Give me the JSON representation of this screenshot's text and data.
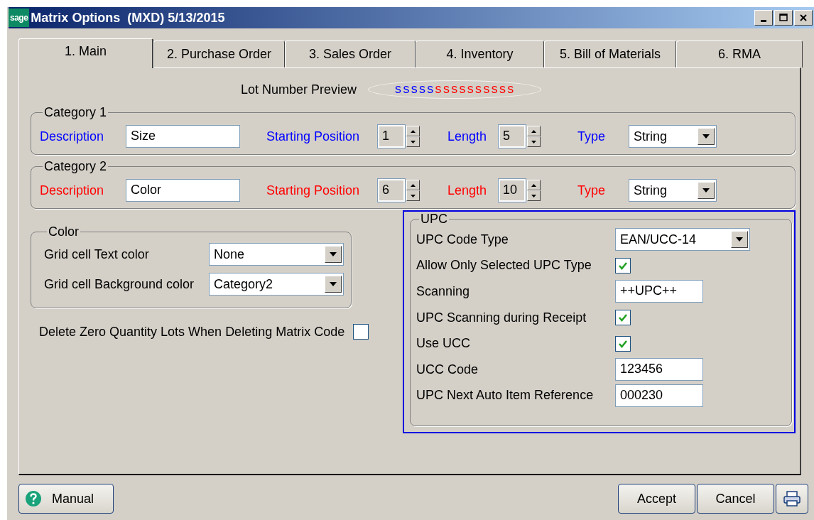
{
  "window": {
    "logo": "sage",
    "title": "Matrix Options  (MXD) 5/13/2015"
  },
  "tabs": [
    {
      "label": "1. Main",
      "selected": true
    },
    {
      "label": "2. Purchase Order",
      "selected": false
    },
    {
      "label": "3. Sales Order",
      "selected": false
    },
    {
      "label": "4. Inventory",
      "selected": false
    },
    {
      "label": "5. Bill of Materials",
      "selected": false
    },
    {
      "label": "6. RMA",
      "selected": false
    }
  ],
  "lot_number_preview": {
    "label": "Lot Number Preview",
    "segments": [
      {
        "text": "sssss",
        "color": "#0000ff"
      },
      {
        "text": "ssssssssss",
        "color": "#ff0000"
      }
    ]
  },
  "categories": [
    {
      "title": "Category 1",
      "color": "#0000ff",
      "description_label": "Description",
      "description": "Size",
      "start_label": "Starting Position",
      "start": "1",
      "length_label": "Length",
      "length": "5",
      "type_label": "Type",
      "type": "String"
    },
    {
      "title": "Category 2",
      "color": "#ff0000",
      "description_label": "Description",
      "description": "Color",
      "start_label": "Starting Position",
      "start": "6",
      "length_label": "Length",
      "length": "10",
      "type_label": "Type",
      "type": "String"
    }
  ],
  "color_group": {
    "title": "Color",
    "rows": [
      {
        "label": "Grid cell Text color",
        "value": "None"
      },
      {
        "label": "Grid cell Background color",
        "value": "Category2"
      }
    ]
  },
  "delete_zero_lots": {
    "label": "Delete Zero Quantity Lots When Deleting Matrix Code",
    "checked": false
  },
  "upc": {
    "title": "UPC",
    "rows": [
      {
        "kind": "select",
        "label": "UPC Code Type",
        "value": "EAN/UCC-14"
      },
      {
        "kind": "checkbox",
        "label": "Allow Only Selected UPC Type",
        "checked": true
      },
      {
        "kind": "text",
        "label": "Scanning",
        "value": "++UPC++"
      },
      {
        "kind": "checkbox",
        "label": "UPC Scanning during Receipt",
        "checked": true
      },
      {
        "kind": "checkbox",
        "label": "Use UCC",
        "checked": true
      },
      {
        "kind": "text",
        "label": "UCC Code",
        "value": "123456"
      },
      {
        "kind": "text",
        "label": "UPC Next Auto Item Reference",
        "value": "000230"
      }
    ]
  },
  "buttons": {
    "manual": "Manual",
    "accept": "Accept",
    "cancel": "Cancel"
  }
}
